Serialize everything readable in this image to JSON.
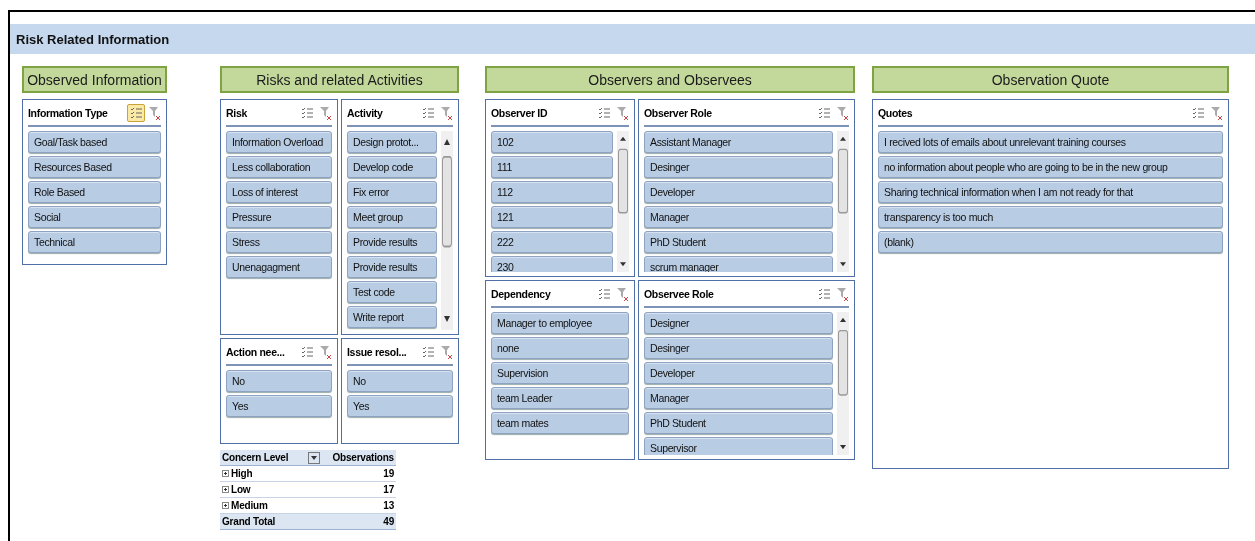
{
  "title": "Risk Related Information",
  "sections": [
    {
      "heading": "Observed Information",
      "slicers": [
        {
          "title": "Information Type",
          "multi_select": true,
          "scrollbar": false,
          "items": [
            "Goal/Task based",
            "Resources Based",
            "Role Based",
            "Social",
            "Technical"
          ]
        }
      ]
    },
    {
      "heading": "Risks and related Activities",
      "slicers": [
        {
          "title": "Risk",
          "multi_select": false,
          "scrollbar": false,
          "items": [
            "Information Overload",
            "Less collaboration",
            "Loss of interest",
            "Pressure",
            "Stress",
            "Unenagagment"
          ]
        },
        {
          "title": "Activity",
          "multi_select": false,
          "scrollbar": true,
          "items": [
            "Design protot...",
            "Develop code",
            "Fix error",
            "Meet group",
            "Provide results",
            "Provide results",
            "Test code",
            "Write report"
          ]
        },
        {
          "title": "Action nee...",
          "multi_select": false,
          "scrollbar": false,
          "items": [
            "No",
            "Yes"
          ]
        },
        {
          "title": "Issue resol...",
          "multi_select": false,
          "scrollbar": false,
          "items": [
            "No",
            "Yes"
          ]
        }
      ],
      "pivot": {
        "columns": [
          "Concern Level",
          "Observations"
        ],
        "rows": [
          {
            "label": "High",
            "value": "19"
          },
          {
            "label": "Low",
            "value": "17"
          },
          {
            "label": "Medium",
            "value": "13"
          }
        ],
        "total": {
          "label": "Grand Total",
          "value": "49"
        }
      }
    },
    {
      "heading": "Observers and Observees",
      "slicers": [
        {
          "title": "Observer ID",
          "multi_select": false,
          "scrollbar": true,
          "items": [
            "102",
            "111",
            "112",
            "121",
            "222",
            "230"
          ]
        },
        {
          "title": "Observer Role",
          "multi_select": false,
          "scrollbar": true,
          "items": [
            "Assistant Manager",
            "Desinger",
            "Developer",
            "Manager",
            "PhD Student",
            "scrum manager"
          ]
        },
        {
          "title": "Dependency",
          "multi_select": false,
          "scrollbar": false,
          "items": [
            "Manager to employee",
            "none",
            "Supervision",
            "team Leader",
            "team mates"
          ]
        },
        {
          "title": "Observee Role",
          "multi_select": false,
          "scrollbar": true,
          "items": [
            "Designer",
            "Desinger",
            "Developer",
            "Manager",
            "PhD Student",
            "Supervisor"
          ]
        }
      ]
    },
    {
      "heading": "Observation Quote",
      "slicers": [
        {
          "title": "Quotes",
          "multi_select": false,
          "scrollbar": false,
          "items": [
            "I recived lots of emails about unrelevant training courses",
            "no information about people who are going to be in the new group",
            "Sharing technical information when I am not ready for that",
            "transparency is too much",
            "(blank)"
          ]
        }
      ]
    }
  ]
}
